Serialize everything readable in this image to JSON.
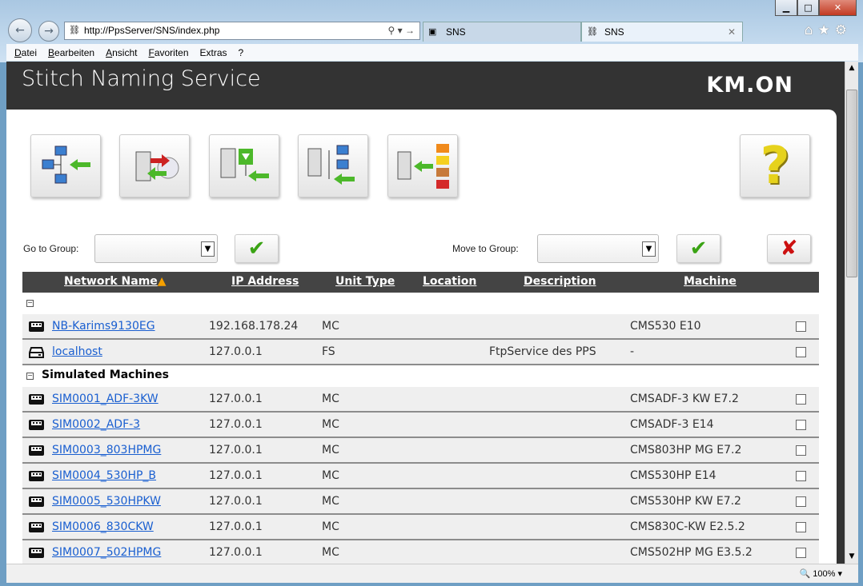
{
  "browser": {
    "url": "http://PpsServer/SNS/index.php",
    "tabs": [
      {
        "label": "SNS",
        "icon": "pps-icon"
      },
      {
        "label": "SNS",
        "icon": "network-icon"
      }
    ],
    "menu": [
      {
        "label": "Datei",
        "key": "D"
      },
      {
        "label": "Bearbeiten",
        "key": "B"
      },
      {
        "label": "Ansicht",
        "key": "A"
      },
      {
        "label": "Favoriten",
        "key": "F"
      },
      {
        "label": "Extras",
        "key": "t"
      },
      {
        "label": "?",
        "key": "?"
      }
    ],
    "zoom": "100%"
  },
  "app": {
    "title": "Stitch Naming Service",
    "logo": "KM.ON"
  },
  "toolbar": {
    "buttons": [
      "add-network-unit",
      "backup-restore",
      "import",
      "network-tree",
      "pd-assign"
    ],
    "help": "help"
  },
  "groups": {
    "goto_label": "Go to Group:",
    "goto_value": "",
    "move_label": "Move to Group:",
    "move_value": "",
    "accent_ok": "#3aa314",
    "accent_cancel": "#cc1111"
  },
  "table": {
    "headers": [
      "Network Name",
      "IP Address",
      "Unit Type",
      "Location",
      "Description",
      "Machine"
    ],
    "sort_column": "Network Name",
    "sort_dir": "asc",
    "groups": [
      {
        "name": "",
        "rows": [
          {
            "icon": "machine-icon",
            "name": "NB-Karims9130EG",
            "ip": "192.168.178.24",
            "type": "MC",
            "location": "",
            "description": "",
            "machine": "CMS530 E10"
          },
          {
            "icon": "drive-icon",
            "name": "localhost",
            "ip": "127.0.0.1",
            "type": "FS",
            "location": "",
            "description": "FtpService des PPS",
            "machine": "-"
          }
        ]
      },
      {
        "name": "Simulated Machines",
        "rows": [
          {
            "icon": "machine-icon",
            "name": "SIM0001_ADF-3KW",
            "ip": "127.0.0.1",
            "type": "MC",
            "location": "",
            "description": "",
            "machine": "CMSADF-3 KW E7.2"
          },
          {
            "icon": "machine-icon",
            "name": "SIM0002_ADF-3",
            "ip": "127.0.0.1",
            "type": "MC",
            "location": "",
            "description": "",
            "machine": "CMSADF-3 E14"
          },
          {
            "icon": "machine-icon",
            "name": "SIM0003_803HPMG",
            "ip": "127.0.0.1",
            "type": "MC",
            "location": "",
            "description": "",
            "machine": "CMS803HP MG E7.2"
          },
          {
            "icon": "machine-icon",
            "name": "SIM0004_530HP_B",
            "ip": "127.0.0.1",
            "type": "MC",
            "location": "",
            "description": "",
            "machine": "CMS530HP E14"
          },
          {
            "icon": "machine-icon",
            "name": "SIM0005_530HPKW",
            "ip": "127.0.0.1",
            "type": "MC",
            "location": "",
            "description": "",
            "machine": "CMS530HP KW E7.2"
          },
          {
            "icon": "machine-icon",
            "name": "SIM0006_830CKW",
            "ip": "127.0.0.1",
            "type": "MC",
            "location": "",
            "description": "",
            "machine": "CMS830C-KW E2.5.2"
          },
          {
            "icon": "machine-icon",
            "name": "SIM0007_502HPMG",
            "ip": "127.0.0.1",
            "type": "MC",
            "location": "",
            "description": "",
            "machine": "CMS502HP MG E3.5.2"
          }
        ]
      }
    ]
  }
}
